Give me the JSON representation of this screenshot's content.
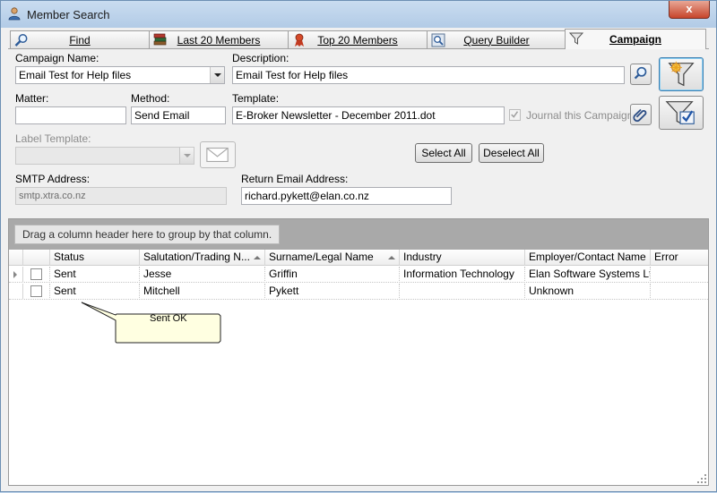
{
  "window": {
    "title": "Member Search",
    "close_label": "x"
  },
  "tabs": [
    {
      "label": "Find",
      "icon": "search-icon"
    },
    {
      "label": "Last 20 Members",
      "icon": "books-icon"
    },
    {
      "label": "Top 20 Members",
      "icon": "award-icon"
    },
    {
      "label": "Query Builder",
      "icon": "query-icon"
    },
    {
      "label": "Campaign",
      "icon": "funnel-icon",
      "active": true
    }
  ],
  "form": {
    "campaign_name_label": "Campaign Name:",
    "campaign_name_value": "Email Test for Help files",
    "description_label": "Description:",
    "description_value": "Email Test for Help files",
    "matter_label": "Matter:",
    "matter_value": "",
    "method_label": "Method:",
    "method_value": "Send Email",
    "template_label": "Template:",
    "template_value": "E-Broker Newsletter - December 2011.dot",
    "journal_label": "Journal this Campaign",
    "journal_checked": true,
    "label_template_label": "Label Template:",
    "label_template_value": "",
    "select_all_label": "Select All",
    "deselect_all_label": "Deselect All",
    "smtp_label": "SMTP Address:",
    "smtp_value": "smtp.xtra.co.nz",
    "return_email_label": "Return Email Address:",
    "return_email_value": "richard.pykett@elan.co.nz"
  },
  "grid": {
    "group_hint": "Drag a column header here to group by that column.",
    "columns": [
      "Status",
      "Salutation/Trading N...",
      "Surname/Legal Name",
      "Industry",
      "Employer/Contact Name",
      "Error"
    ],
    "rows": [
      {
        "status": "Sent",
        "salutation": "Jesse",
        "surname": "Griffin",
        "industry": "Information Technology",
        "employer": "Elan Software Systems Ltd",
        "error": "",
        "current": true
      },
      {
        "status": "Sent",
        "salutation": "Mitchell",
        "surname": "Pykett",
        "industry": "",
        "employer": "Unknown",
        "error": "",
        "current": false
      }
    ]
  },
  "tooltip": {
    "text": "Sent OK"
  },
  "colors": {
    "title_bar": "#bcd3ea",
    "close_button": "#c7452b",
    "group_panel": "#a9a9a9",
    "tooltip_bg": "#ffffe1"
  }
}
